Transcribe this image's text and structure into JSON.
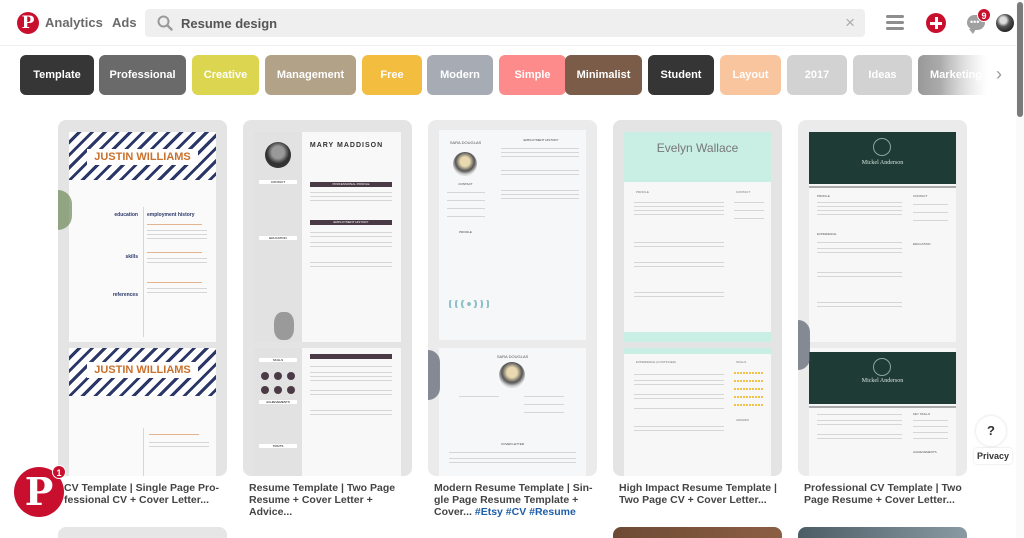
{
  "header": {
    "logo_glyph": "P",
    "nav": [
      "Analytics",
      "Ads"
    ],
    "search": {
      "value": "Resume design",
      "clear_glyph": "×"
    },
    "notifications_count": "9"
  },
  "chips": [
    {
      "label": "Template",
      "color": "#363636"
    },
    {
      "label": "Professional",
      "color": "#6b6a6a"
    },
    {
      "label": "Creative",
      "color": "#dbd54f"
    },
    {
      "label": "Management",
      "color": "#b2a287"
    },
    {
      "label": "Free",
      "color": "#f3bd3f"
    },
    {
      "label": "Modern",
      "color": "#a7acb4"
    },
    {
      "label": "Simple",
      "color": "#fd8b8b"
    },
    {
      "label": "Minimalist",
      "color": "#7a5c48"
    },
    {
      "label": "Student",
      "color": "#353535"
    },
    {
      "label": "Layout",
      "color": "#f9c59f"
    },
    {
      "label": "2017",
      "color": "#d2d2d2"
    },
    {
      "label": "Ideas",
      "color": "#d2d2d2"
    },
    {
      "label": "Marketing",
      "color": "#9a9a9a"
    }
  ],
  "chip_next_glyph": "›",
  "pins": [
    {
      "title": "CV Template | Single Page Pro-fessional CV + Cover Letter...",
      "tags": "",
      "resume_name": "JUSTIN WILLIAMS",
      "sections": [
        "education",
        "employment history",
        "skills",
        "references"
      ]
    },
    {
      "title": "Resume Template | Two Page Resume + Cover Letter + Advice...",
      "tags": "",
      "resume_name": "MARY MADDISON",
      "sections": [
        "PROFESSIONAL PROFILE",
        "EMPLOYMENT HISTORY",
        "CONTACT",
        "EDUCATION",
        "SKILLS",
        "ACHIEVEMENTS",
        "TRAITS"
      ]
    },
    {
      "title": "Modern Resume Template | Sin-gle Page Resume Template + Cover... ",
      "tags": "#Etsy #CV #Resume",
      "resume_name": "SARA DOUGLAS",
      "sections": [
        "EMPLOYMENT HISTORY",
        "CONTACT",
        "PROFILE",
        "COVER LETTER"
      ]
    },
    {
      "title": "High Impact Resume Template | Two Page CV + Cover Letter...",
      "tags": "",
      "resume_name": "Evelyn Wallace",
      "sections": [
        "PROFILE",
        "CONTACT",
        "EXPERIENCE (CONTINUED)",
        "SKILLS",
        "AWARDS"
      ]
    },
    {
      "title": "Professional CV Template | Two Page Resume + Cover Letter...",
      "tags": "",
      "resume_name": "Mickel Anderson",
      "sections": [
        "PROFILE",
        "CONTACT",
        "EXPERIENCE",
        "EDUCATION",
        "KEY SKILLS",
        "ACHIEVEMENTS"
      ]
    }
  ],
  "floating": {
    "logo_glyph": "P",
    "badge": "1"
  },
  "help": {
    "glyph": "?",
    "privacy_label": "Privacy"
  }
}
